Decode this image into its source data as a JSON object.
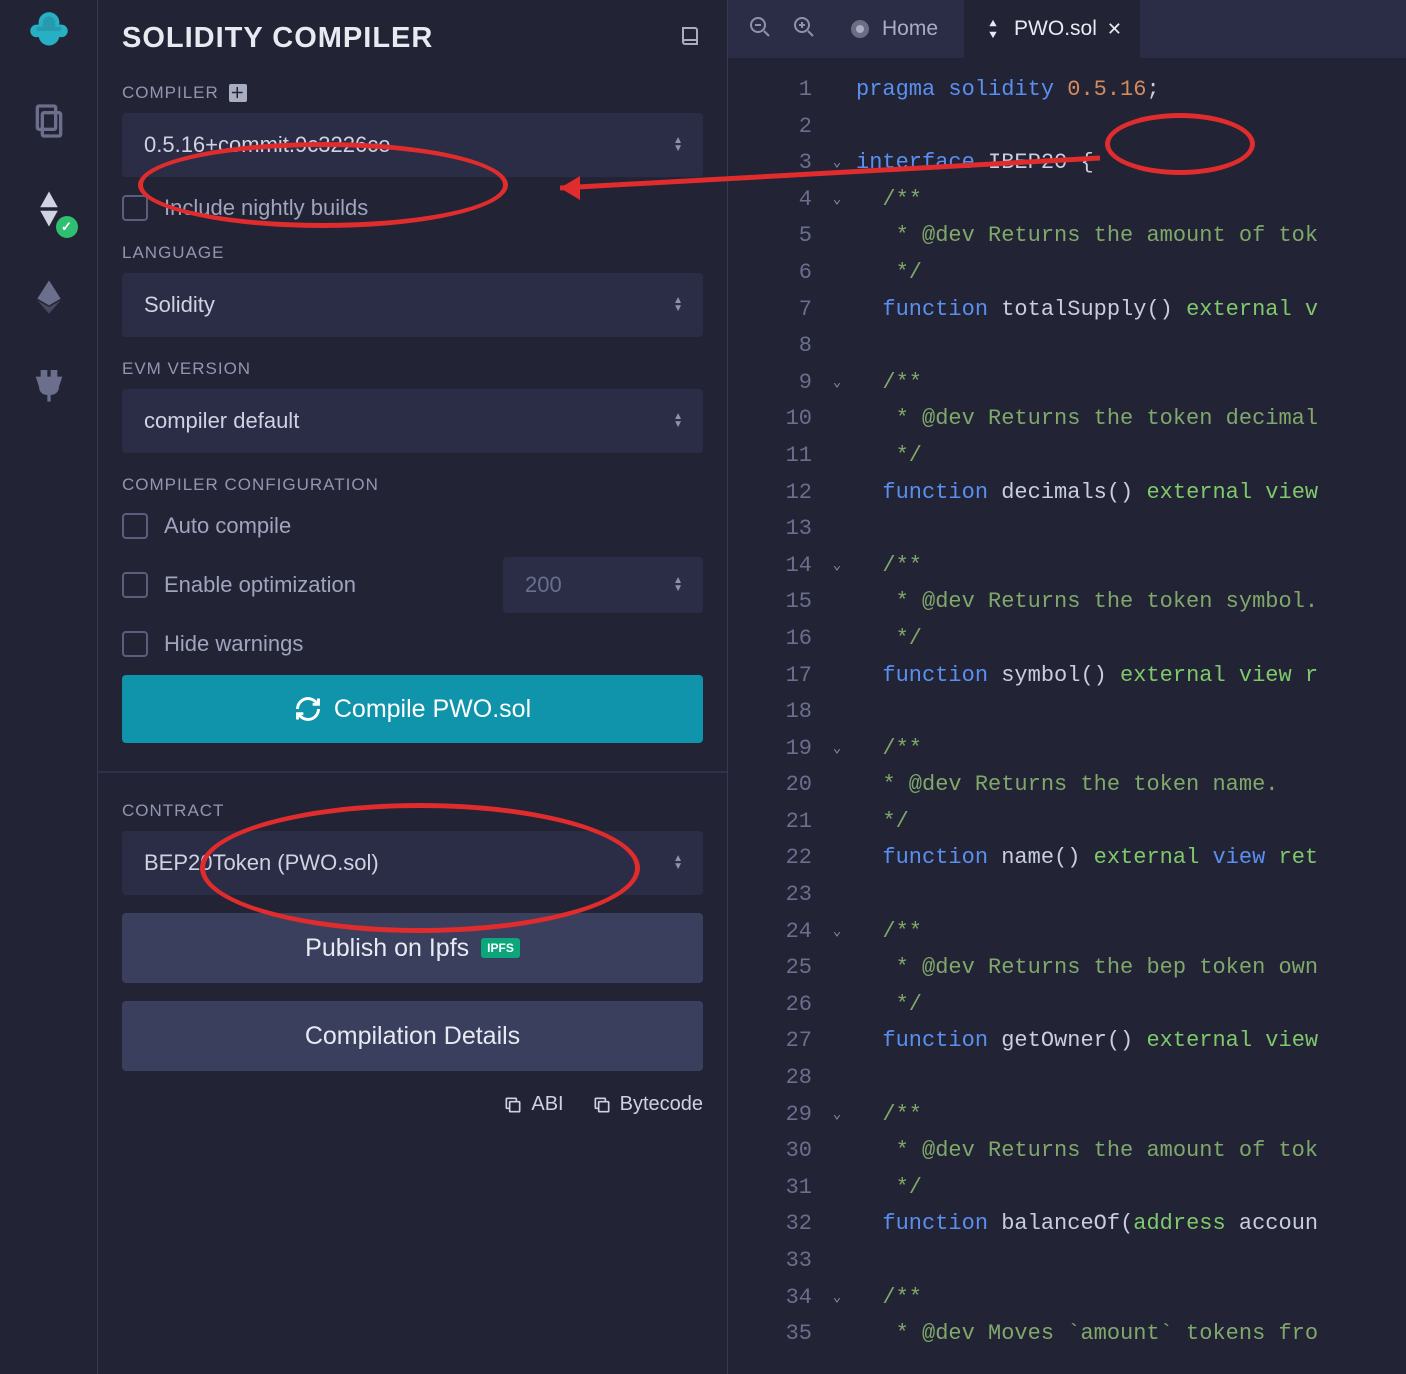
{
  "panel": {
    "title": "SOLIDITY COMPILER",
    "compiler_label": "COMPILER",
    "compiler_value": "0.5.16+commit.9c3226ce",
    "nightly_label": "Include nightly builds",
    "language_label": "LANGUAGE",
    "language_value": "Solidity",
    "evm_label": "EVM VERSION",
    "evm_value": "compiler default",
    "config_label": "COMPILER CONFIGURATION",
    "auto_label": "Auto compile",
    "opt_label": "Enable optimization",
    "opt_value": "200",
    "hide_label": "Hide warnings",
    "compile_btn": "Compile PWO.sol",
    "contract_label": "CONTRACT",
    "contract_value": "BEP20Token (PWO.sol)",
    "ipfs_btn": "Publish on Ipfs",
    "ipfs_badge": "IPFS",
    "details_btn": "Compilation Details",
    "abi_label": "ABI",
    "bytecode_label": "Bytecode"
  },
  "tabs": {
    "home": "Home",
    "file": "PWO.sol"
  },
  "editor": {
    "foldable_lines": [
      3,
      4,
      9,
      14,
      19,
      24,
      29,
      34
    ],
    "lines": [
      [
        [
          "kw",
          "pragma "
        ],
        [
          "kw",
          "solidity "
        ],
        [
          "st",
          "0.5.16"
        ],
        [
          "pl",
          ";"
        ]
      ],
      [],
      [
        [
          "kw",
          "interface "
        ],
        [
          "fn",
          "IBEP20 "
        ],
        [
          "pl",
          "{"
        ]
      ],
      [
        [
          "pl",
          "  "
        ],
        [
          "cm",
          "/**"
        ]
      ],
      [
        [
          "pl",
          "  "
        ],
        [
          "cm",
          " * @dev Returns the amount of tok"
        ]
      ],
      [
        [
          "pl",
          "  "
        ],
        [
          "cm",
          " */"
        ]
      ],
      [
        [
          "pl",
          "  "
        ],
        [
          "kw",
          "function "
        ],
        [
          "fn",
          "totalSupply"
        ],
        [
          "pl",
          "()"
        ],
        [
          "gr",
          " external v"
        ]
      ],
      [],
      [
        [
          "pl",
          "  "
        ],
        [
          "cm",
          "/**"
        ]
      ],
      [
        [
          "pl",
          "  "
        ],
        [
          "cm",
          " * @dev Returns the token decimal"
        ]
      ],
      [
        [
          "pl",
          "  "
        ],
        [
          "cm",
          " */"
        ]
      ],
      [
        [
          "pl",
          "  "
        ],
        [
          "kw",
          "function "
        ],
        [
          "fn",
          "decimals"
        ],
        [
          "pl",
          "()"
        ],
        [
          "gr",
          " external view"
        ]
      ],
      [],
      [
        [
          "pl",
          "  "
        ],
        [
          "cm",
          "/**"
        ]
      ],
      [
        [
          "pl",
          "  "
        ],
        [
          "cm",
          " * @dev Returns the token symbol."
        ]
      ],
      [
        [
          "pl",
          "  "
        ],
        [
          "cm",
          " */"
        ]
      ],
      [
        [
          "pl",
          "  "
        ],
        [
          "kw",
          "f"
        ],
        [
          "kw",
          "unction "
        ],
        [
          "fn",
          "symbol"
        ],
        [
          "pl",
          "()"
        ],
        [
          "gr",
          " external view r"
        ]
      ],
      [],
      [
        [
          "pl",
          "  "
        ],
        [
          "cm",
          "/**"
        ]
      ],
      [
        [
          "pl",
          "  "
        ],
        [
          "cm",
          "* @dev Returns the token name."
        ]
      ],
      [
        [
          "pl",
          "  "
        ],
        [
          "cm",
          "*/"
        ]
      ],
      [
        [
          "pl",
          "  "
        ],
        [
          "kw",
          "function "
        ],
        [
          "fn",
          "name"
        ],
        [
          "pl",
          "()"
        ],
        [
          "gr",
          " external "
        ],
        [
          "kw",
          "view"
        ],
        [
          "gr",
          " ret"
        ]
      ],
      [],
      [
        [
          "pl",
          "  "
        ],
        [
          "cm",
          "/**"
        ]
      ],
      [
        [
          "pl",
          "  "
        ],
        [
          "cm",
          " * @dev Returns the bep token own"
        ]
      ],
      [
        [
          "pl",
          "  "
        ],
        [
          "cm",
          " */"
        ]
      ],
      [
        [
          "pl",
          "  "
        ],
        [
          "kw",
          "function "
        ],
        [
          "fn",
          "getOwner"
        ],
        [
          "pl",
          "()"
        ],
        [
          "gr",
          " external view"
        ]
      ],
      [],
      [
        [
          "pl",
          "  "
        ],
        [
          "cm",
          "/**"
        ]
      ],
      [
        [
          "pl",
          "  "
        ],
        [
          "cm",
          " * @dev Returns the amount of tok"
        ]
      ],
      [
        [
          "pl",
          "  "
        ],
        [
          "cm",
          " */"
        ]
      ],
      [
        [
          "pl",
          "  "
        ],
        [
          "kw",
          "function "
        ],
        [
          "fn",
          "balanceOf"
        ],
        [
          "pl",
          "("
        ],
        [
          "ty",
          "address"
        ],
        [
          "pl",
          " accoun"
        ]
      ],
      [],
      [
        [
          "pl",
          "  "
        ],
        [
          "cm",
          "/**"
        ]
      ],
      [
        [
          "pl",
          "  "
        ],
        [
          "cm",
          " * @dev Moves `amount` tokens fro"
        ]
      ]
    ]
  },
  "colors": {
    "accent": "#0f94ab",
    "annotation": "#e02c2c"
  }
}
